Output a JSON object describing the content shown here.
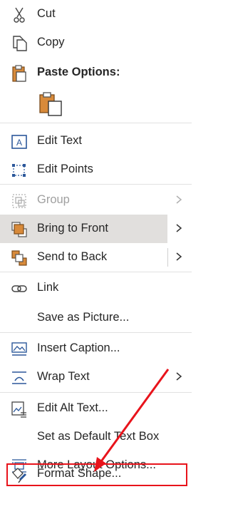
{
  "menu": {
    "cut": "Cut",
    "copy": "Copy",
    "paste_options": "Paste Options:",
    "edit_text": "Edit Text",
    "edit_points": "Edit Points",
    "group": "Group",
    "bring_to_front": "Bring to Front",
    "send_to_back": "Send to Back",
    "link": "Link",
    "save_as_picture": "Save as Picture...",
    "insert_caption": "Insert Caption...",
    "wrap_text": "Wrap Text",
    "edit_alt_text": "Edit Alt Text...",
    "set_default_text_box": "Set as Default Text Box",
    "more_layout_options": "More Layout Options...",
    "format_shape": "Format Shape..."
  },
  "colors": {
    "highlight": "#e1dfdd",
    "annotation_red": "#e8131b",
    "icon_blue": "#2b579a",
    "icon_orange": "#d88a3a"
  }
}
